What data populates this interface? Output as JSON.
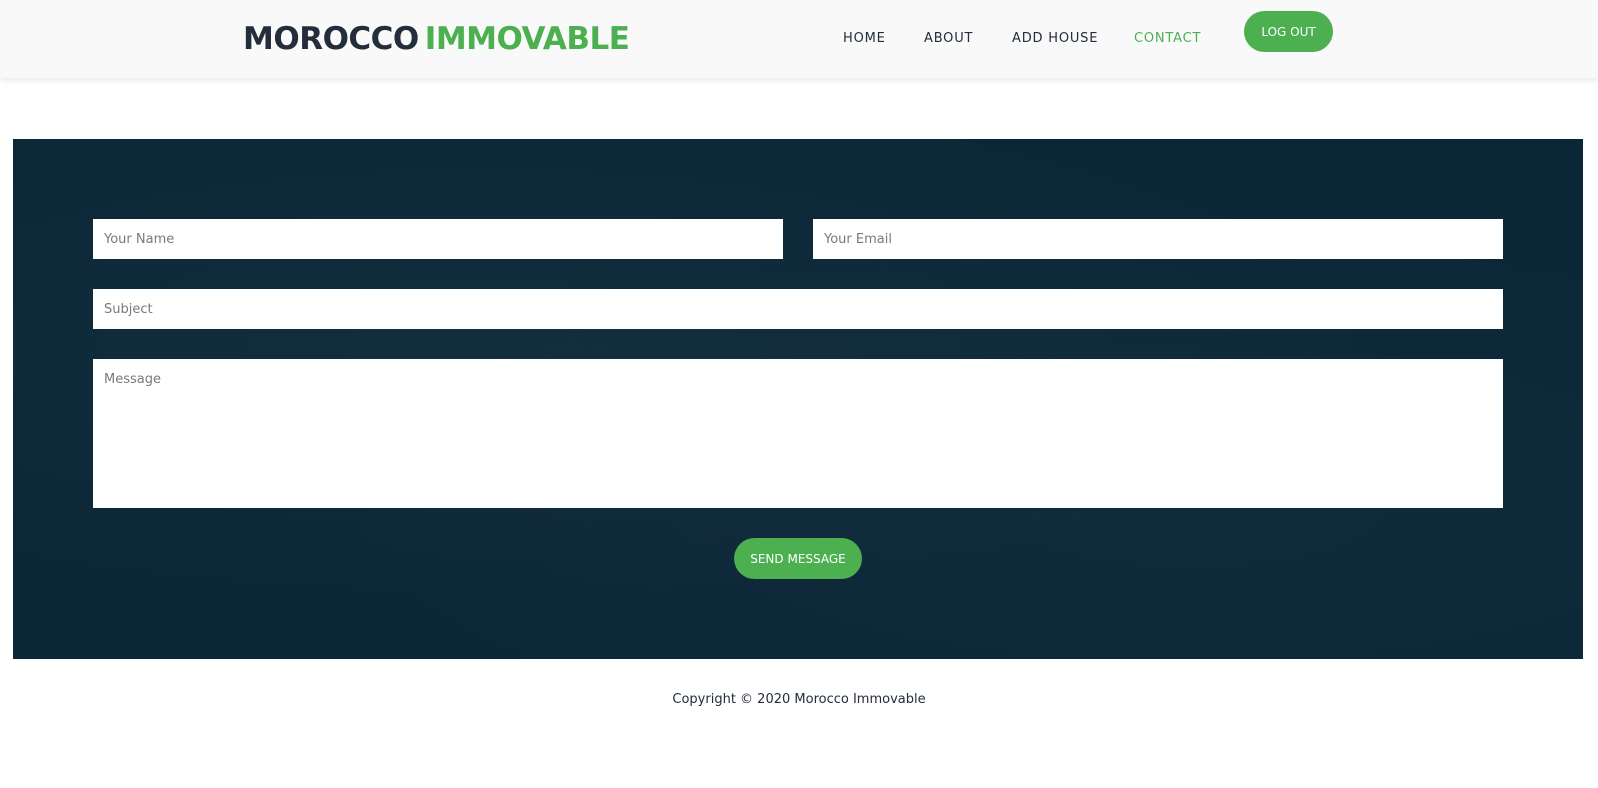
{
  "header": {
    "logo_part1": "MOROCCO",
    "logo_part2": "IMMOVABLE",
    "nav": {
      "home": "HOME",
      "about": "ABOUT",
      "add_house": "ADD HOUSE",
      "contact": "CONTACT",
      "logout": "LOG OUT"
    },
    "active_item": "CONTACT"
  },
  "contact_form": {
    "name_placeholder": "Your Name",
    "email_placeholder": "Your Email",
    "subject_placeholder": "Subject",
    "message_placeholder": "Message",
    "send_label": "SEND MESSAGE"
  },
  "footer": {
    "copyright": "Copyright © 2020 Morocco Immovable"
  },
  "colors": {
    "accent": "#4caf50",
    "dark_text": "#232d3b",
    "section_bg": "#0b2737"
  }
}
